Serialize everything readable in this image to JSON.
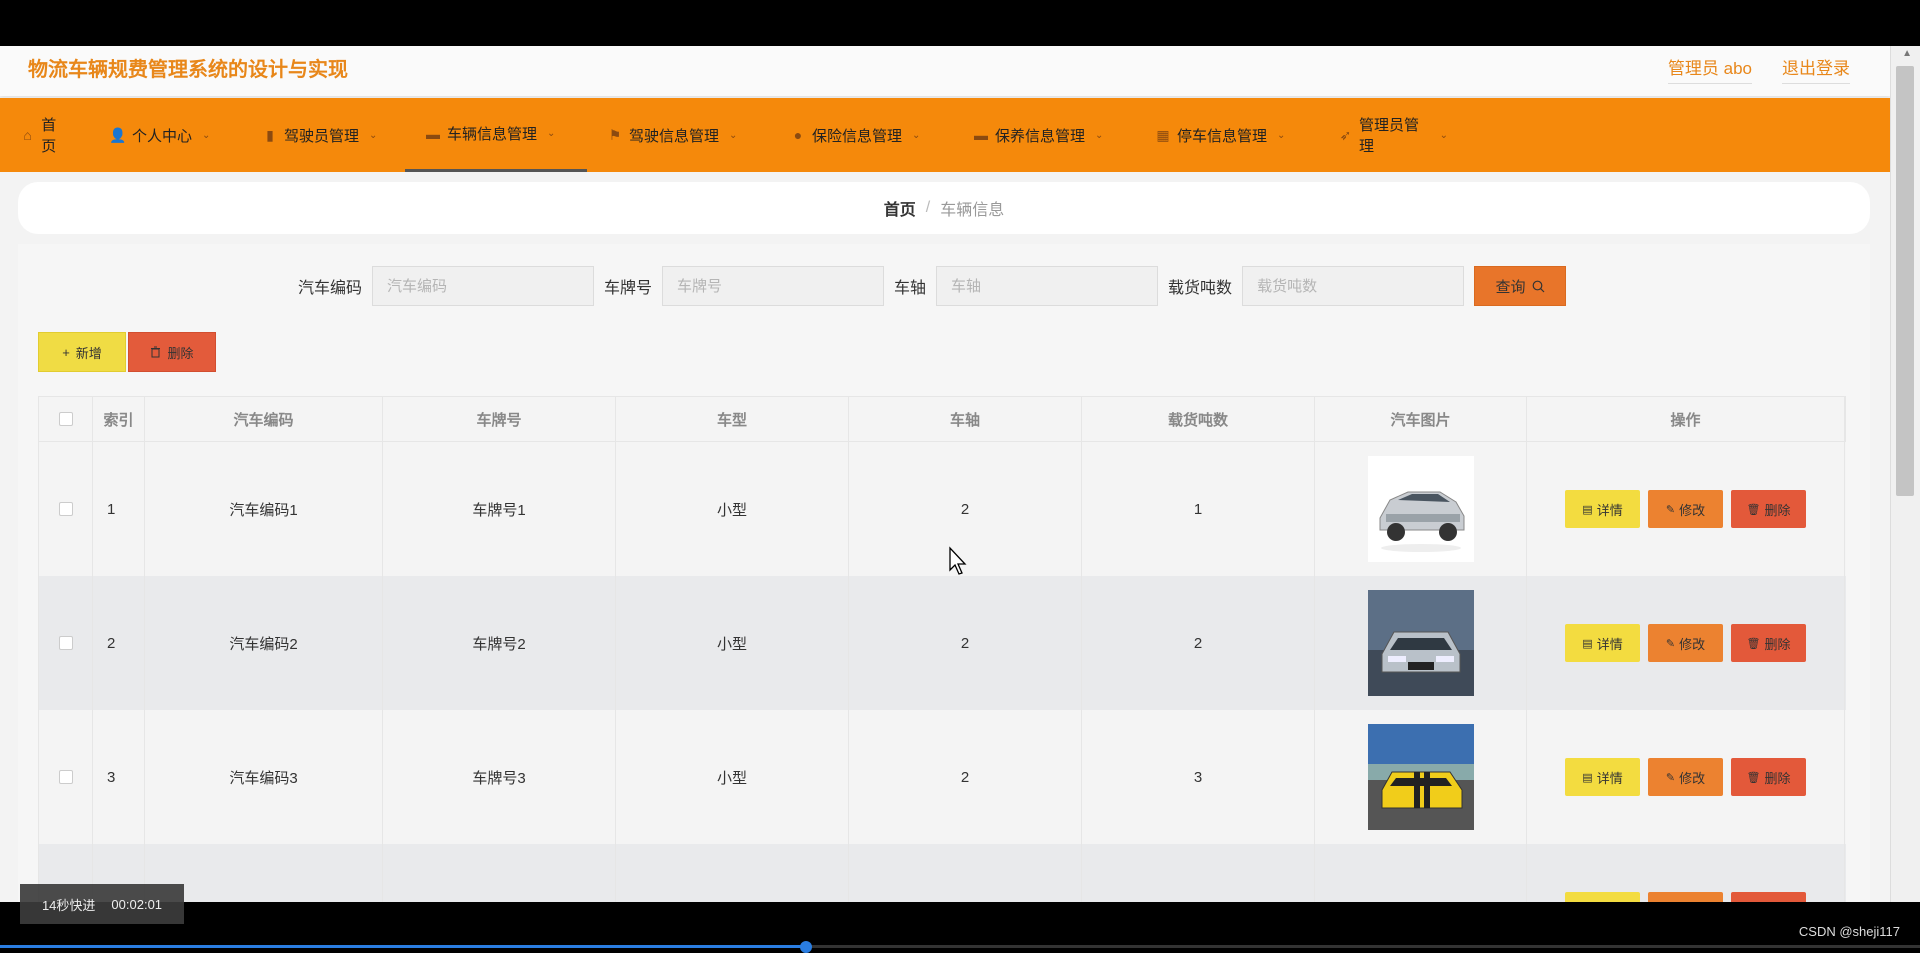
{
  "app": {
    "title": "物流车辆规费管理系统的设计与实现",
    "user_label": "管理员 abo",
    "logout_label": "退出登录"
  },
  "nav": [
    {
      "label": "首页",
      "icon": "home-icon",
      "glyph": "⌂",
      "has_chevron": false
    },
    {
      "label": "个人中心",
      "icon": "user-icon",
      "glyph": "👤",
      "has_chevron": true
    },
    {
      "label": "驾驶员管理",
      "icon": "bar-chart-icon",
      "glyph": "▮",
      "has_chevron": true
    },
    {
      "label": "车辆信息管理",
      "icon": "chat-icon",
      "glyph": "▬",
      "has_chevron": true,
      "active": true
    },
    {
      "label": "驾驶信息管理",
      "icon": "flag-icon",
      "glyph": "⚑",
      "has_chevron": true
    },
    {
      "label": "保险信息管理",
      "icon": "location-icon",
      "glyph": "●",
      "has_chevron": true
    },
    {
      "label": "保养信息管理",
      "icon": "chat-icon",
      "glyph": "▬",
      "has_chevron": true
    },
    {
      "label": "停车信息管理",
      "icon": "grid-icon",
      "glyph": "▦",
      "has_chevron": true
    },
    {
      "label": "管理员管理",
      "icon": "send-icon",
      "glyph": "➶",
      "has_chevron": true
    }
  ],
  "breadcrumb": {
    "home": "首页",
    "separator": "/",
    "current": "车辆信息"
  },
  "search": {
    "fields": [
      {
        "label": "汽车编码",
        "placeholder": "汽车编码",
        "value": ""
      },
      {
        "label": "车牌号",
        "placeholder": "车牌号",
        "value": ""
      },
      {
        "label": "车轴",
        "placeholder": "车轴",
        "value": ""
      },
      {
        "label": "载货吨数",
        "placeholder": "载货吨数",
        "value": ""
      }
    ],
    "query_label": "查询"
  },
  "actions": {
    "add_label": "新增",
    "delete_label": "删除"
  },
  "table": {
    "headers": [
      "索引",
      "汽车编码",
      "车牌号",
      "车型",
      "车轴",
      "载货吨数",
      "汽车图片",
      "操作"
    ],
    "rows": [
      {
        "index": "1",
        "code": "汽车编码1",
        "plate": "车牌号1",
        "type": "小型",
        "axle": "2",
        "tonnage": "1",
        "image": "silver-suv"
      },
      {
        "index": "2",
        "code": "汽车编码2",
        "plate": "车牌号2",
        "type": "小型",
        "axle": "2",
        "tonnage": "2",
        "image": "gray-sedan"
      },
      {
        "index": "3",
        "code": "汽车编码3",
        "plate": "车牌号3",
        "type": "小型",
        "axle": "2",
        "tonnage": "3",
        "image": "yellow-sports"
      },
      {
        "index": "",
        "code": "",
        "plate": "",
        "type": "",
        "axle": "",
        "tonnage": "",
        "image": "partial"
      }
    ],
    "op_labels": {
      "detail": "详情",
      "edit": "修改",
      "delete": "删除"
    }
  },
  "player": {
    "speed_text": "14秒快进",
    "time_text": "00:02:01",
    "progress_percent": 42
  },
  "watermark": "CSDN @sheji117",
  "colors": {
    "nav_bg": "#f5890b",
    "title": "#e8871a",
    "query": "#e8752a",
    "add": "#f0dc44",
    "delete": "#e35b3b"
  }
}
